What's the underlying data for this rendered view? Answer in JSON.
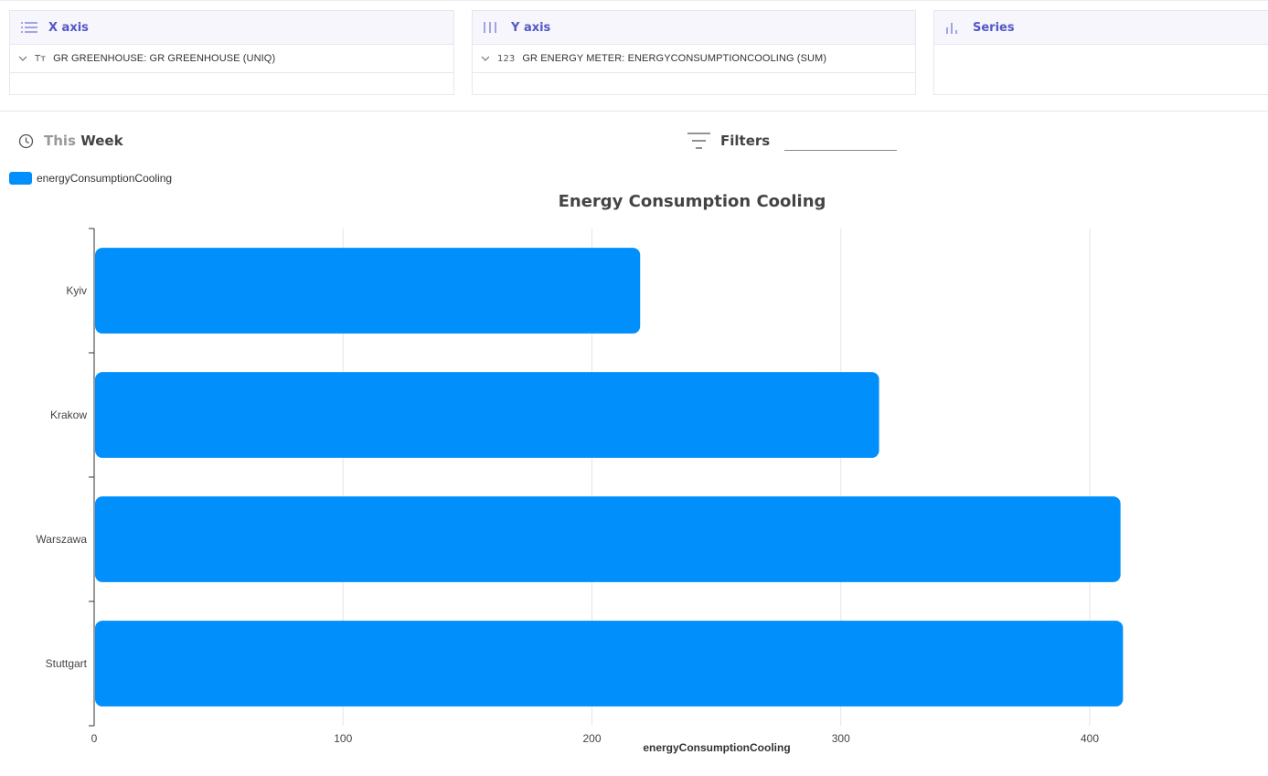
{
  "panels": {
    "x_axis": {
      "title": "X axis",
      "icon": "list-icon",
      "field_type": "Tт",
      "field": "GR GREENHOUSE: GR GREENHOUSE (UNIQ)"
    },
    "y_axis": {
      "title": "Y axis",
      "icon": "columns-icon",
      "field_type": "123",
      "field": "GR ENERGY METER: ENERGYCONSUMPTIONCOOLING (SUM)"
    },
    "series": {
      "title": "Series",
      "icon": "bar-chart-icon"
    }
  },
  "period": {
    "prefix": "This",
    "value": "Week",
    "icon": "clock-icon"
  },
  "filters": {
    "label": "Filters",
    "icon": "filter-icon",
    "value": ""
  },
  "legend": {
    "label": "energyConsumptionCooling",
    "color": "#008ffb"
  },
  "chart_data": {
    "type": "bar",
    "orientation": "horizontal",
    "title": "Energy Consumption Cooling",
    "categories": [
      "Kyiv",
      "Krakow",
      "Warszawa",
      "Stuttgart"
    ],
    "series": [
      {
        "name": "energyConsumptionCooling",
        "values": [
          219,
          315,
          412,
          413
        ]
      }
    ],
    "xlabel": "energyConsumptionCooling",
    "ylabel": "",
    "xlim": [
      0,
      440
    ],
    "xticks": [
      0,
      100,
      200,
      300,
      400
    ],
    "grid": true,
    "legend_position": "top-left",
    "color": "#008ffb"
  }
}
